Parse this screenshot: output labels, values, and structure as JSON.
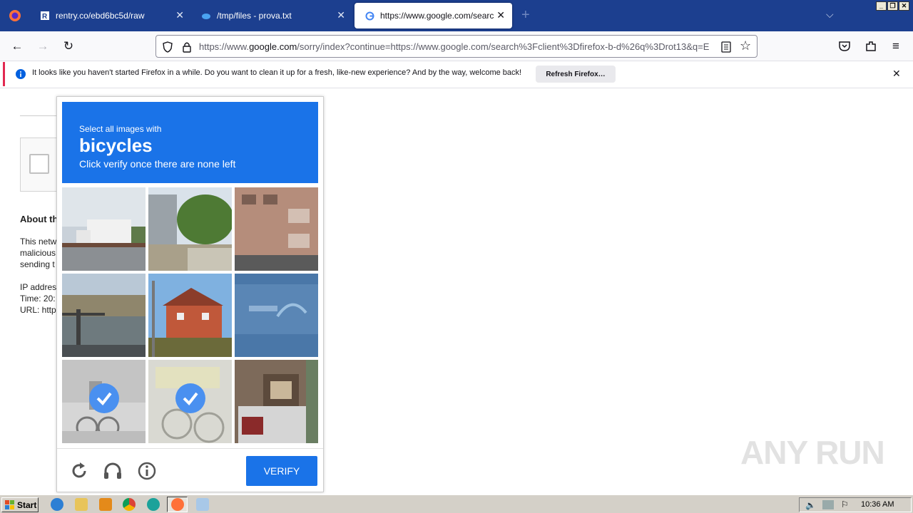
{
  "browser": {
    "tabs": [
      {
        "label": "rentry.co/ebd6bc5d/raw",
        "active": false
      },
      {
        "label": "/tmp/files - prova.txt",
        "active": false
      },
      {
        "label": "https://www.google.com/search?c",
        "active": true
      }
    ],
    "url": {
      "prefix": "https://www.",
      "domain": "google.com",
      "rest": "/sorry/index?continue=https://www.google.com/search%3Fclient%3Dfirefox-b-d%26q%3Drot13&q=E"
    }
  },
  "notification": {
    "text": "It looks like you haven't started Firefox in a while. Do you want to clean it up for a fresh, like-new experience? And by the way, welcome back!",
    "button": "Refresh Firefox…"
  },
  "background_page": {
    "heading": "About th",
    "para_lines": [
      "This netw",
      "malicious",
      "sending t"
    ],
    "ip_line": "IP addres",
    "time_line": "Time: 20:",
    "url_line": "URL: http"
  },
  "captcha": {
    "instruction": "Select all images with",
    "target": "bicycles",
    "subtext": "Click verify once there are none left",
    "tiles": [
      {
        "scene": "white-house",
        "selected": false
      },
      {
        "scene": "green-street",
        "selected": false
      },
      {
        "scene": "apartment",
        "selected": false
      },
      {
        "scene": "bridge-railing",
        "selected": false
      },
      {
        "scene": "red-house",
        "selected": false
      },
      {
        "scene": "blue-sign",
        "selected": false
      },
      {
        "scene": "cyclist",
        "selected": true
      },
      {
        "scene": "parked-bicycles",
        "selected": true
      },
      {
        "scene": "car-building",
        "selected": false
      }
    ],
    "verify_label": "VERIFY"
  },
  "watermark": "ANY RUN",
  "taskbar": {
    "start_label": "Start",
    "clock": "10:36 AM"
  }
}
